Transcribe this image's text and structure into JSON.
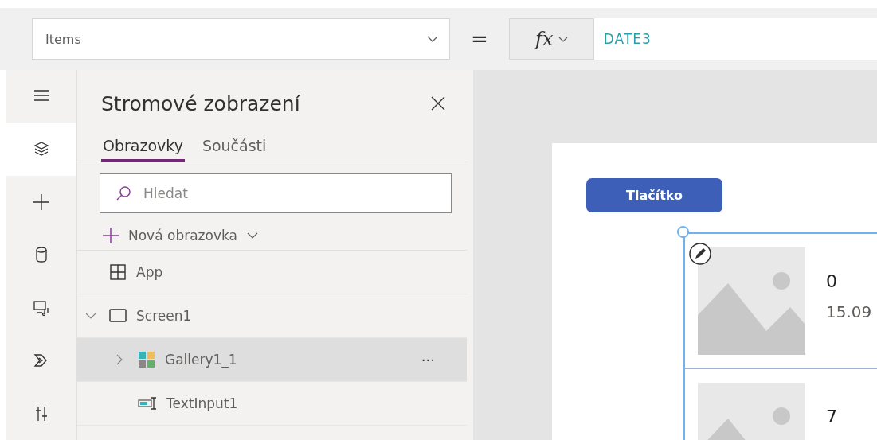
{
  "formula_bar": {
    "property": "Items",
    "equals": "=",
    "fx_label": "fx",
    "formula": "DATE3"
  },
  "rail": [
    {
      "selected": false
    },
    {
      "selected": true
    },
    {
      "selected": false
    },
    {
      "selected": false
    },
    {
      "selected": false
    },
    {
      "selected": false
    },
    {
      "selected": false
    }
  ],
  "tree_panel": {
    "title": "Stromové zobrazení",
    "tabs": [
      {
        "label": "Obrazovky",
        "selected": true
      },
      {
        "label": "Součásti",
        "selected": false
      }
    ],
    "search": {
      "placeholder": "Hledat"
    },
    "new_screen": "Nová obrazovka",
    "items": [
      {
        "kind": "app",
        "label": "App",
        "selected": false
      },
      {
        "kind": "screen",
        "label": "Screen1",
        "selected": false,
        "expanded": true,
        "children": [
          {
            "kind": "gallery",
            "label": "Gallery1_1",
            "selected": true,
            "expanded": false,
            "more": "···"
          },
          {
            "kind": "text-input",
            "label": "TextInput1",
            "selected": false
          }
        ]
      }
    ]
  },
  "canvas": {
    "button": "Tlačítko",
    "gallery": [
      {
        "title": "0",
        "subtitle": "15.09",
        "selected": true
      },
      {
        "title": "7",
        "selected": false
      }
    ]
  }
}
